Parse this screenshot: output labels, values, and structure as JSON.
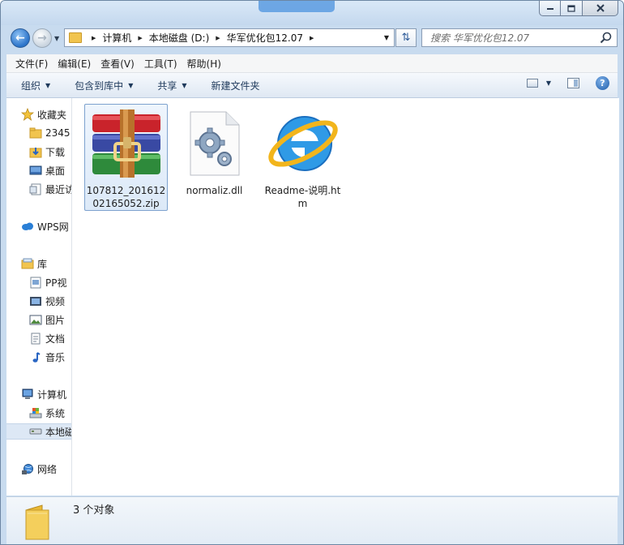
{
  "window": {
    "controls": {
      "minimize": "minimize-icon",
      "maximize": "maximize-icon",
      "close": "close-icon"
    }
  },
  "navigation": {
    "back_icon": "back-arrow-icon",
    "forward_icon": "forward-arrow-icon",
    "breadcrumbs": [
      "计算机",
      "本地磁盘 (D:)",
      "华军优化包12.07"
    ],
    "search_placeholder": "搜索 华军优化包12.07"
  },
  "menubar": [
    "文件(F)",
    "编辑(E)",
    "查看(V)",
    "工具(T)",
    "帮助(H)"
  ],
  "toolbar": {
    "organize": "组织",
    "include_in_library": "包含到库中",
    "share": "共享",
    "new_folder": "新建文件夹"
  },
  "sidebar": {
    "items": [
      {
        "label": "收藏夹",
        "icon": "star-icon"
      },
      {
        "label": "2345",
        "icon": "folder-icon"
      },
      {
        "label": "下载",
        "icon": "downloads-icon"
      },
      {
        "label": "桌面",
        "icon": "desktop-icon"
      },
      {
        "label": "最近访",
        "icon": "recent-places-icon"
      },
      {
        "label": "WPS网",
        "icon": "wps-cloud-icon"
      },
      {
        "label": "库",
        "icon": "library-icon"
      },
      {
        "label": "PP视",
        "icon": "video-library-icon"
      },
      {
        "label": "视频",
        "icon": "video-icon"
      },
      {
        "label": "图片",
        "icon": "pictures-icon"
      },
      {
        "label": "文档",
        "icon": "documents-icon"
      },
      {
        "label": "音乐",
        "icon": "music-icon"
      },
      {
        "label": "计算机",
        "icon": "computer-icon"
      },
      {
        "label": "系统",
        "icon": "system-drive-icon"
      },
      {
        "label": "本地磁",
        "icon": "local-disk-icon"
      },
      {
        "label": "网络",
        "icon": "network-icon"
      }
    ]
  },
  "files": [
    {
      "name": "107812_20161202165052.zip",
      "icon": "winrar-archive-icon",
      "selected": true
    },
    {
      "name": "normaliz.dll",
      "icon": "dll-settings-icon",
      "selected": false
    },
    {
      "name": "Readme-说明.htm",
      "icon": "internet-explorer-icon",
      "selected": false
    }
  ],
  "status": {
    "item_count": "3 个对象"
  },
  "colors": {
    "window_frame": "#c8dbef",
    "toolbar": "#dfe8f3",
    "selection": "#dce9f8",
    "selection_border": "#7da2ce"
  }
}
